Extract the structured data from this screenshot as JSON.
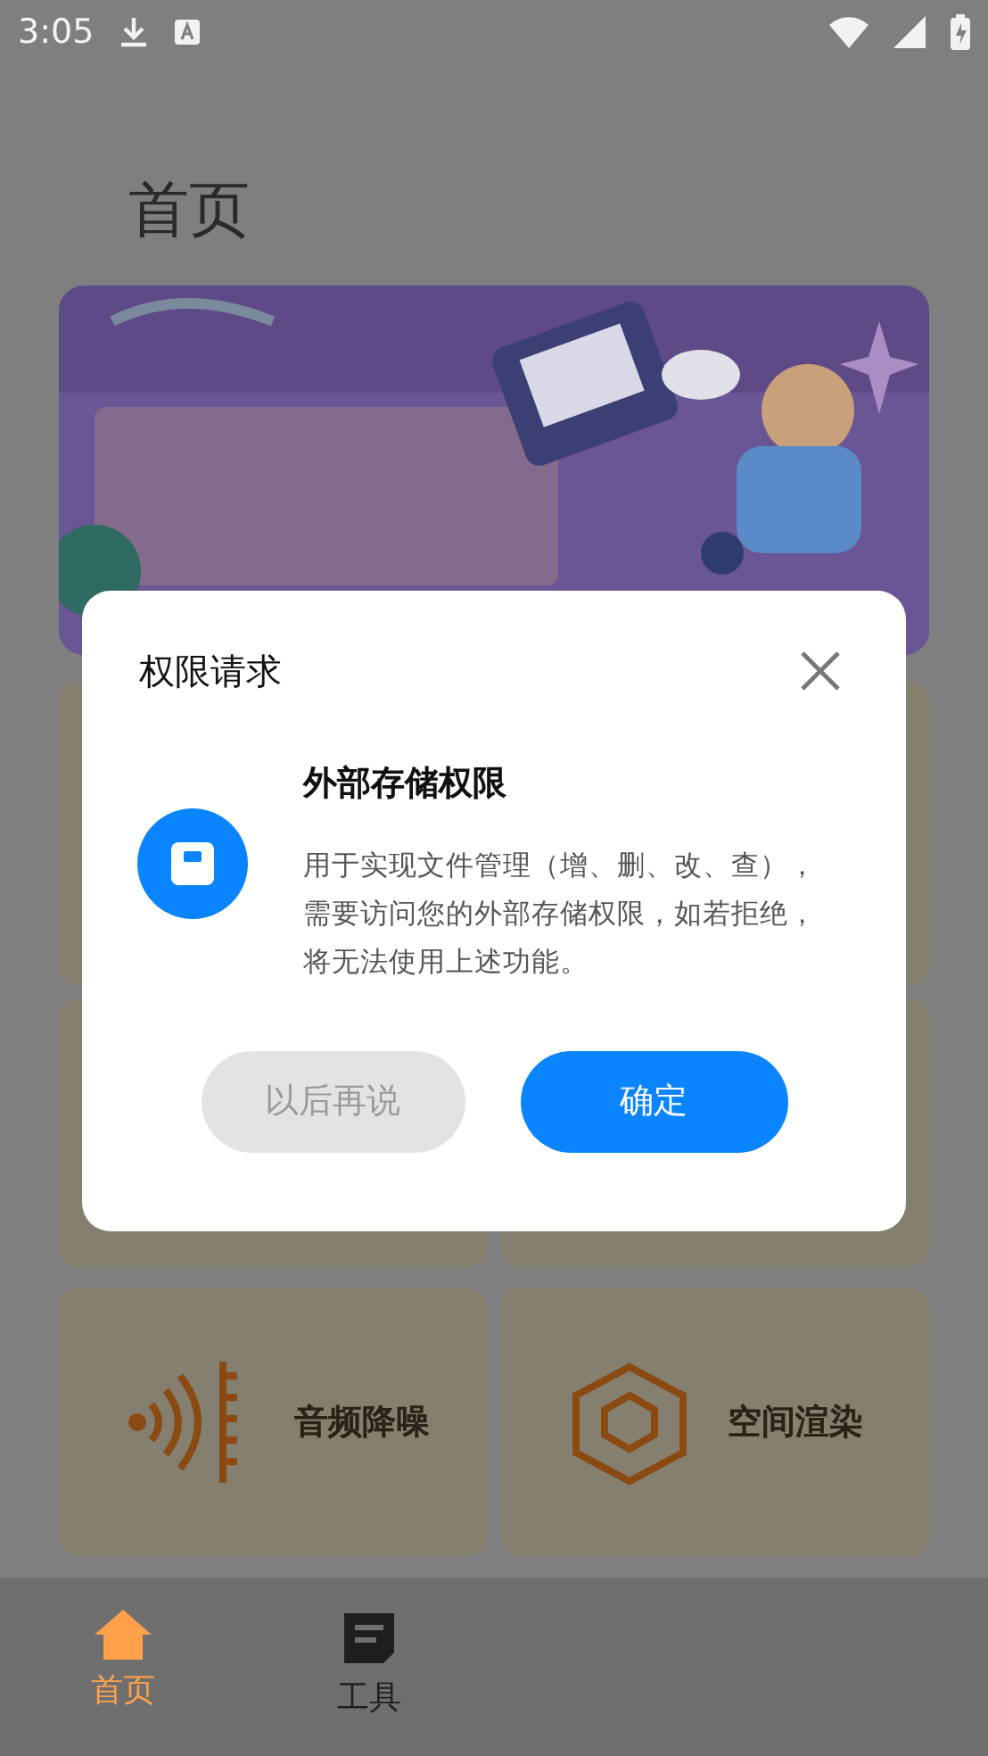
{
  "status_bar": {
    "time": "3:05"
  },
  "page": {
    "title": "首页",
    "tools": [
      {
        "label": "音频降噪",
        "kind": "sound"
      },
      {
        "label": "空间渲染",
        "kind": "cube"
      }
    ]
  },
  "dialog": {
    "title": "权限请求",
    "permission": {
      "name": "外部存储权限",
      "description": "用于实现文件管理（增、删、改、查），需要访问您的外部存储权限，如若拒绝，将无法使用上述功能。"
    },
    "buttons": [
      {
        "label": "以后再说",
        "kind": "secondary"
      },
      {
        "label": "确定",
        "kind": "primary"
      }
    ]
  },
  "bottom_nav": [
    {
      "label": "首页",
      "selected": true,
      "kind": "home"
    },
    {
      "label": "工具",
      "selected": false,
      "kind": "tools"
    }
  ]
}
